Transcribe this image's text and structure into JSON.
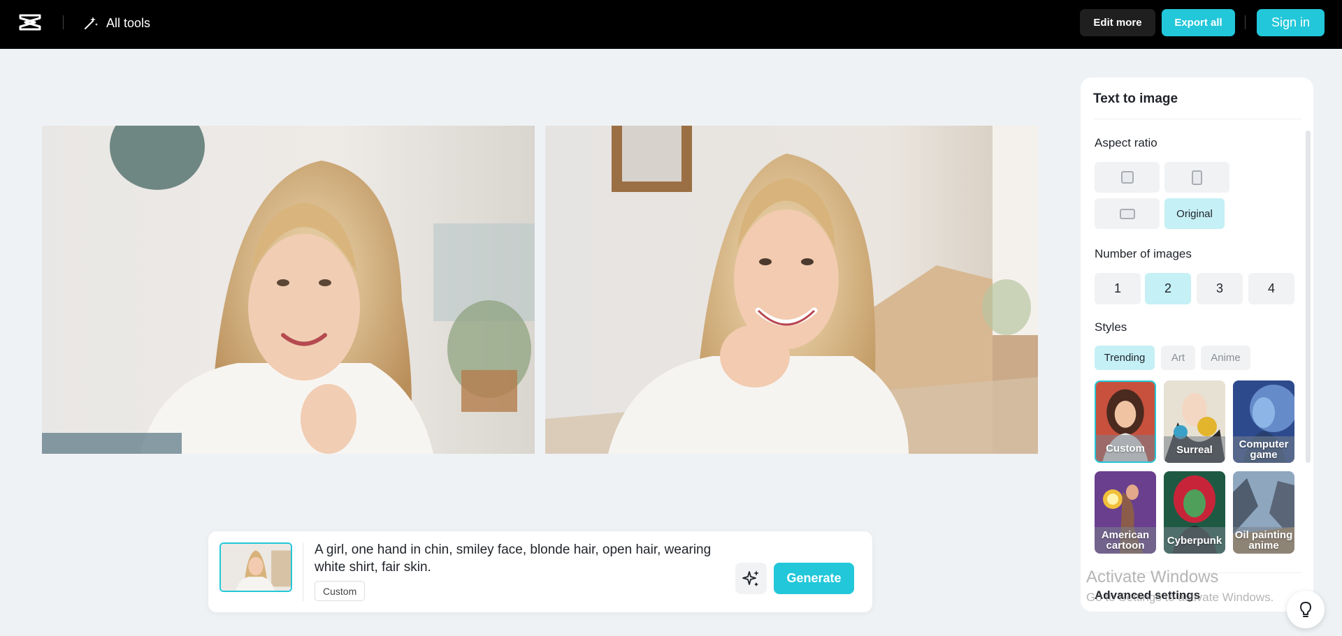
{
  "header": {
    "all_tools": "All tools",
    "edit_more": "Edit more",
    "export_all": "Export all",
    "sign_in": "Sign in"
  },
  "prompt": {
    "text": "A girl, one hand in chin, smiley face, blonde hair, open hair, wearing white shirt, fair skin.",
    "style_tag": "Custom",
    "generate_label": "Generate"
  },
  "panel": {
    "title": "Text to image",
    "aspect_ratio_label": "Aspect ratio",
    "aspect_original": "Original",
    "number_label": "Number of images",
    "numbers": [
      "1",
      "2",
      "3",
      "4"
    ],
    "selected_number": "2",
    "styles_label": "Styles",
    "style_tabs": [
      "Trending",
      "Art",
      "Anime"
    ],
    "styles": [
      "Custom",
      "Surreal",
      "Computer game",
      "American cartoon",
      "Cyberpunk",
      "Oil painting anime"
    ],
    "advanced_label": "Advanced settings"
  },
  "watermark": {
    "line1": "Activate Windows",
    "line2": "Go to Settings to activate Windows."
  },
  "colors": {
    "accent": "#22c7d9",
    "accent_light": "#c5f0f5",
    "header_bg": "#000000",
    "page_bg": "#eff2f5"
  },
  "icons": {
    "logo": "capcut-logo",
    "tools": "magic-wand-icon",
    "magic": "sparkle-icon",
    "help": "lightbulb-icon"
  }
}
